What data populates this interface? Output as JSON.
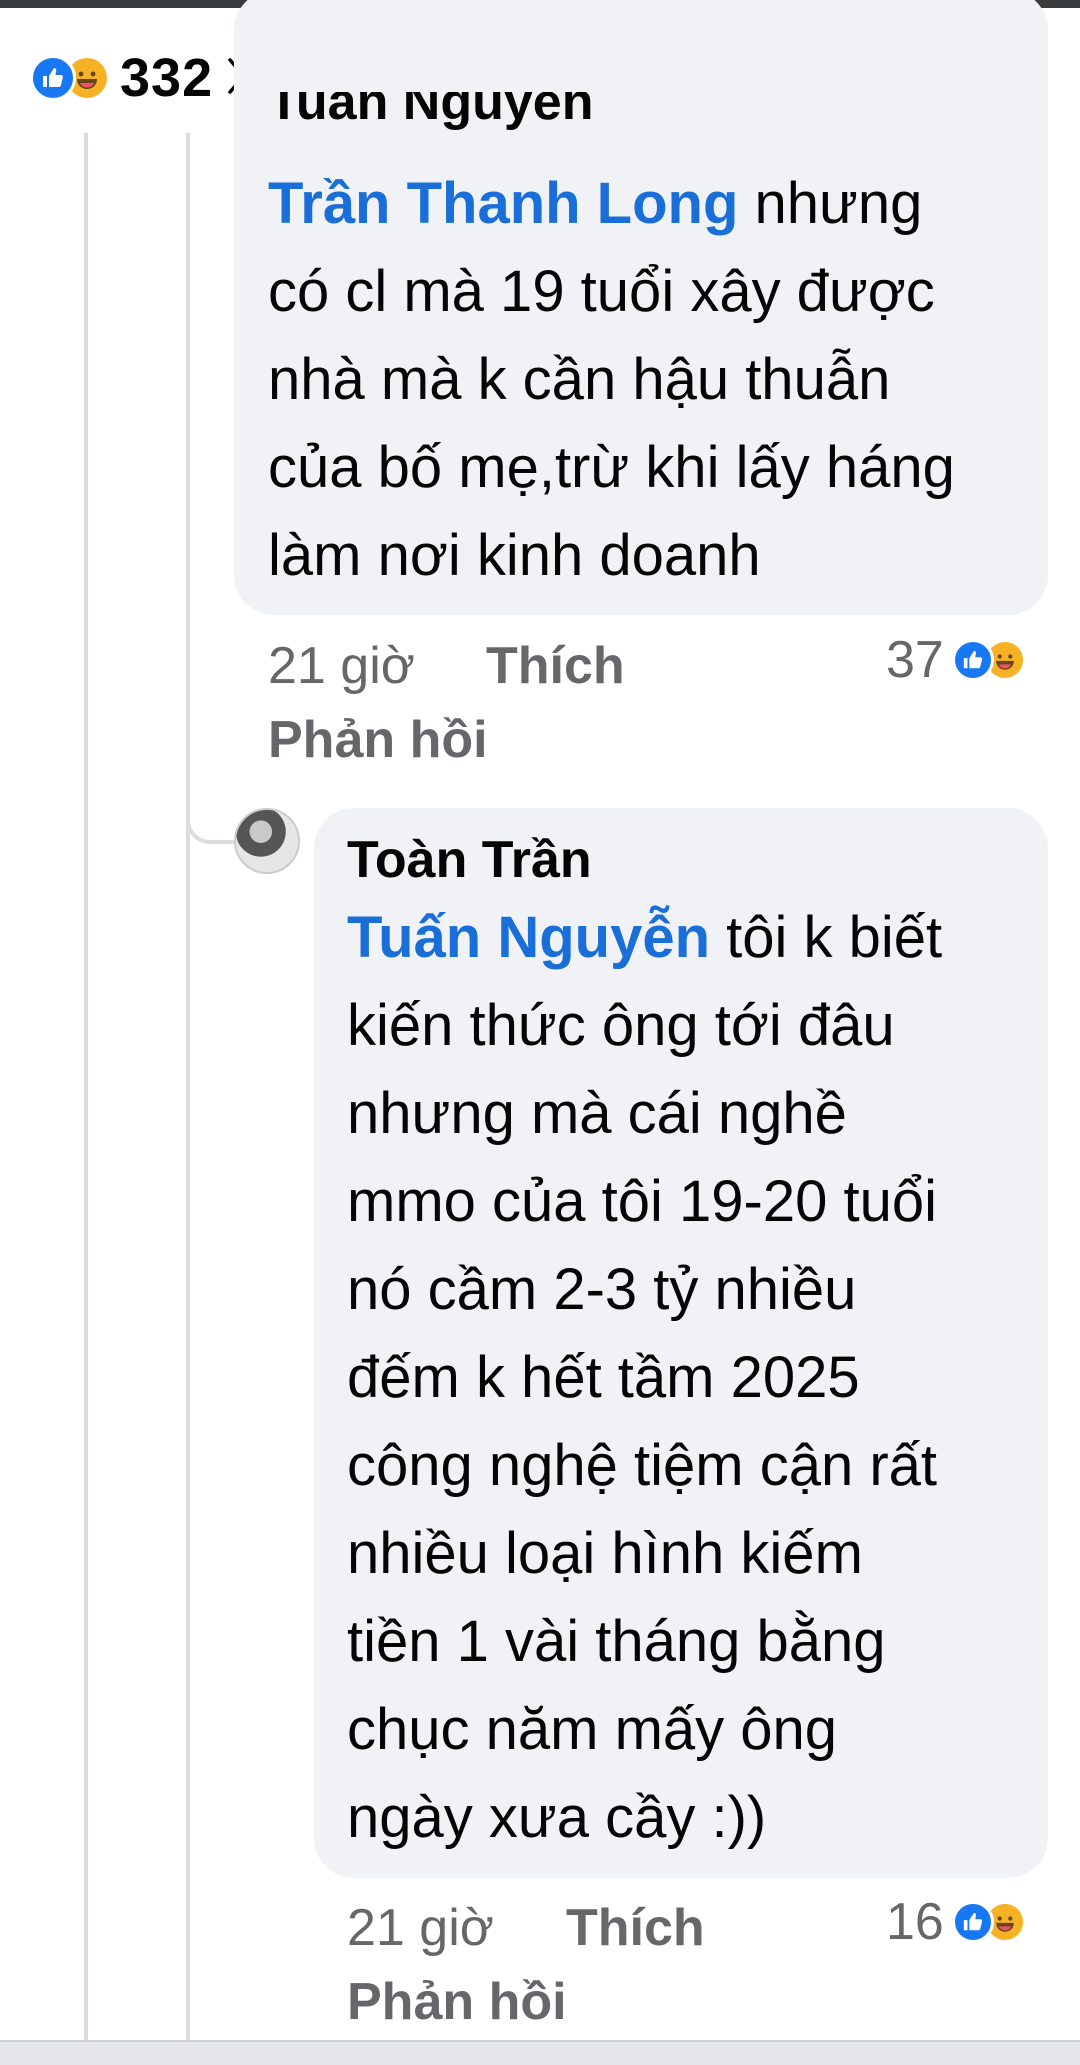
{
  "header": {
    "reaction_count": "332",
    "reaction_icons": [
      "like-icon",
      "haha-icon"
    ],
    "like_button_icon": "thumbs-up-icon"
  },
  "comments": [
    {
      "author_partial": "Tuấn Nguyễn",
      "mention": "Trần Thanh Long",
      "lines": [
        " nhưng",
        "có cl mà 19 tuổi xây được",
        "nhà mà k cần hậu thuẫn",
        "của bố mẹ,trừ khi lấy háng",
        "làm nơi kinh doanh"
      ],
      "time": "21 giờ",
      "like_label": "Thích",
      "reply_label": "Phản hồi",
      "reaction_count": "37"
    },
    {
      "author": "Toàn Trần",
      "mention": "Tuấn Nguyễn",
      "lines": [
        " tôi k biết",
        "kiến thức ông tới đâu",
        "nhưng mà cái nghề",
        "mmo của tôi 19-20 tuổi",
        "nó cầm 2-3 tỷ nhiều",
        "đếm k hết tầm 2025",
        "công nghệ tiệm cận rất",
        "nhiều loại hình kiếm",
        "tiền 1 vài tháng bằng",
        "chục năm mấy ông",
        "ngày xưa cầy :))"
      ],
      "time": "21 giờ",
      "like_label": "Thích",
      "reply_label": "Phản hồi",
      "reaction_count": "16"
    }
  ],
  "colors": {
    "mention": "#1a6ed8",
    "bubble": "#f0f2f5",
    "like": "#1877f2",
    "haha": "#f7b125",
    "meta": "#65676b"
  }
}
